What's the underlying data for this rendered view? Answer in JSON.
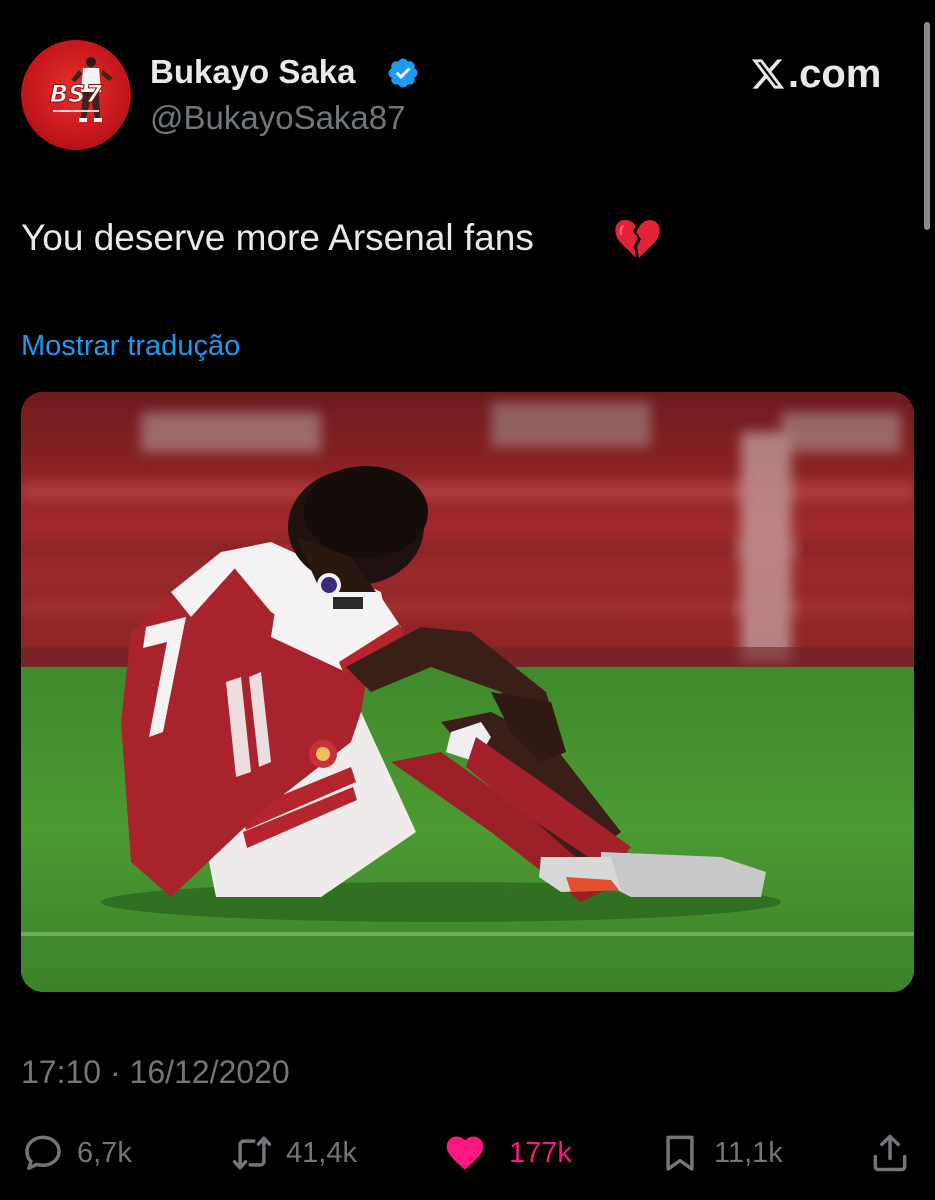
{
  "author": {
    "display_name": "Bukayo Saka",
    "handle": "@BukayoSaka87",
    "avatar_text": "BS7",
    "verified": true
  },
  "brand": {
    "label": ".com",
    "logo_icon": "x-logo-icon"
  },
  "tweet": {
    "text": "You deserve more Arsenal fans",
    "emoji_icon": "broken-heart-icon",
    "translate_label": "Mostrar tradução",
    "timestamp": "17:10 · 16/12/2020",
    "image_alt": "Arsenal player wearing number 7 sitting dejected on the pitch"
  },
  "actions": {
    "replies": {
      "icon": "reply-icon",
      "count": "6,7k"
    },
    "retweets": {
      "icon": "retweet-icon",
      "count": "41,4k"
    },
    "likes": {
      "icon": "heart-icon",
      "count": "177k",
      "liked": true
    },
    "bookmarks": {
      "icon": "bookmark-icon",
      "count": "11,1k"
    },
    "share": {
      "icon": "share-icon"
    }
  },
  "colors": {
    "background": "#000000",
    "primary_text": "#e7e9ea",
    "secondary_text": "#71767b",
    "link": "#1d9bf0",
    "like": "#f91880",
    "verified": "#1d9bf0"
  }
}
